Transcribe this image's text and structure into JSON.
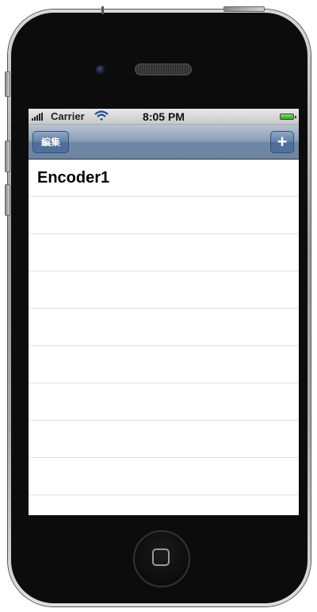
{
  "status_bar": {
    "carrier": "Carrier",
    "time": "8:05 PM",
    "battery_color": "#3cbf2a"
  },
  "nav_bar": {
    "edit_label": "編集",
    "add_label": "+",
    "tint_color": "#6d85a1"
  },
  "table": {
    "rows": [
      {
        "label": "Encoder1"
      },
      {
        "label": ""
      },
      {
        "label": ""
      },
      {
        "label": ""
      },
      {
        "label": ""
      },
      {
        "label": ""
      },
      {
        "label": ""
      },
      {
        "label": ""
      },
      {
        "label": ""
      }
    ]
  },
  "icons": {
    "signal": "signal-bars-icon",
    "wifi": "wifi-icon",
    "battery": "battery-icon",
    "add": "plus-icon",
    "home": "home-button-icon"
  }
}
